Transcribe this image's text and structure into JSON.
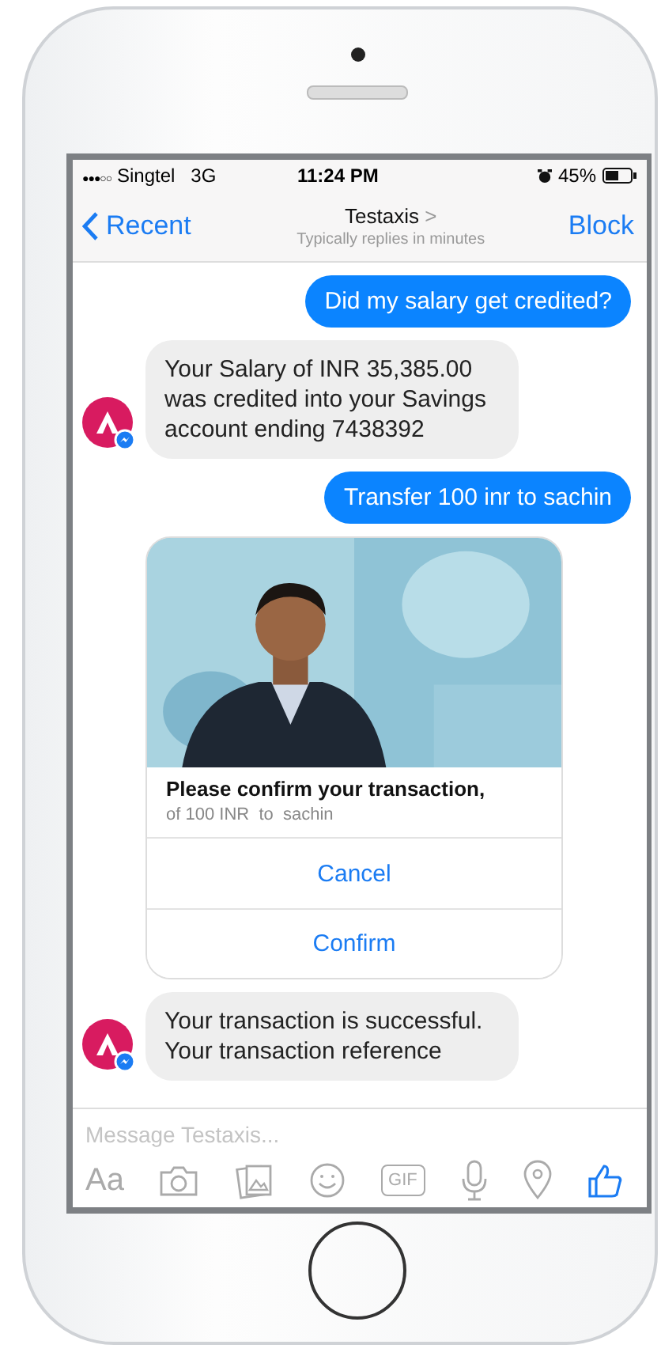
{
  "status_bar": {
    "signal": "●●●○○",
    "carrier": "Singtel",
    "network": "3G",
    "time": "11:24 PM",
    "battery": "45%"
  },
  "nav": {
    "back": "Recent",
    "title": "Testaxis",
    "title_arrow": ">",
    "subtitle": "Typically replies in minutes",
    "action": "Block"
  },
  "messages": [
    {
      "kind": "outgoing",
      "text": "Did my salary get credited?"
    },
    {
      "kind": "incoming",
      "text": "Your Salary of INR 35,385.00 was credited into your Savings account ending 7438392"
    },
    {
      "kind": "outgoing",
      "text": "Transfer 100 inr to sachin"
    },
    {
      "kind": "card",
      "title": "Please confirm your transaction,",
      "subtitle": "of 100 INR  to  sachin",
      "buttons": [
        "Cancel",
        "Confirm"
      ]
    },
    {
      "kind": "incoming",
      "text": "Your transaction is successful. Your transaction reference"
    }
  ],
  "composer": {
    "placeholder": "Message Testaxis..."
  },
  "toolbar": [
    {
      "kind": "text",
      "label": "Aa"
    },
    {
      "kind": "camera"
    },
    {
      "kind": "gallery"
    },
    {
      "kind": "emoji"
    },
    {
      "kind": "text-badge",
      "label": "GIF"
    },
    {
      "kind": "mic"
    },
    {
      "kind": "location"
    },
    {
      "kind": "like"
    }
  ]
}
